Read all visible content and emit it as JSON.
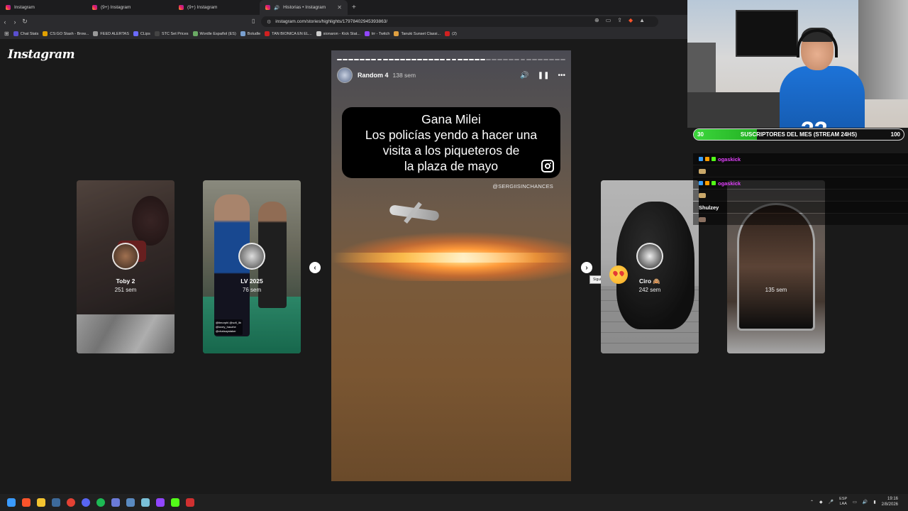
{
  "browser": {
    "tabs": [
      {
        "label": "Instagram",
        "active": false
      },
      {
        "label": "(9+) Instagram",
        "active": false
      },
      {
        "label": "(9+) Instagram",
        "active": false
      },
      {
        "label": "Historias • Instagram",
        "active": true
      }
    ],
    "new_tab": "+",
    "url": "instagram.com/stories/highlights/17978402945393863/",
    "bookmarks": [
      {
        "label": "Chat Stats",
        "color": "#5a4fcf"
      },
      {
        "label": "CS:GO Stash - Brow...",
        "color": "#e0a000"
      },
      {
        "label": "FEED ALERTAS",
        "color": "#999999"
      },
      {
        "label": "CLips",
        "color": "#6b6bff"
      },
      {
        "label": "STC Set Prices",
        "color": "#444444"
      },
      {
        "label": "Wordle Español (ES)",
        "color": "#6aaa64"
      },
      {
        "label": "Boludle",
        "color": "#7aa0d0"
      },
      {
        "label": "TAN BIONICA EN EL...",
        "color": "#d02020"
      },
      {
        "label": "sionaron - Kick Stat...",
        "color": "#cccccc"
      },
      {
        "label": "trr - Twitch",
        "color": "#9146ff"
      },
      {
        "label": "Tanuki Sunset Classi...",
        "color": "#e0a040"
      },
      {
        "label": "(2)",
        "color": "#d02020"
      }
    ]
  },
  "instagram": {
    "logo": "Instagram",
    "side_stories": [
      {
        "name": "Toby 2",
        "time": "251 sem"
      },
      {
        "name": "LV 2025",
        "time": "76 sem",
        "tags": "@timorphl @sofi_lib @lovey_hauzhe @chatsaystaker"
      },
      {
        "name": "Ciro 🙈",
        "time": "242 sem"
      },
      {
        "name": "",
        "time": "135 sem"
      }
    ],
    "prev_icon": "chevron-left-icon",
    "next_icon": "chevron-right-icon",
    "next_tooltip": "Siguiente",
    "main_story": {
      "username": "Random 4",
      "time": "138 sem",
      "progress_segments": 40,
      "progress_current": 26,
      "caption_lines": [
        "Gana Milei",
        "Los policías yendo a hacer una",
        "visita a los piqueteros de",
        "la plaza de mayo"
      ],
      "watermark": "@SERGIISINCHANCES",
      "controls": {
        "mute": "🔊",
        "pause": "❚❚",
        "more": "•••"
      }
    }
  },
  "stream_overlay": {
    "goal": {
      "current": "30",
      "title": "SUSCRIPTORES DEL MES (STREAM 24HS)",
      "target": "100",
      "progress": 0.3
    },
    "chat": [
      {
        "user": "ogaskick",
        "user_color": "#e040fb"
      },
      {
        "user": "ogaskick",
        "user_color": "#e040fb"
      },
      {
        "user": "Shulzey",
        "user_color": "#ffffff"
      }
    ]
  },
  "taskbar": {
    "lang_top": "ESP",
    "lang_bottom": "LAA",
    "time": "19:16",
    "date": "2/8/2026"
  }
}
